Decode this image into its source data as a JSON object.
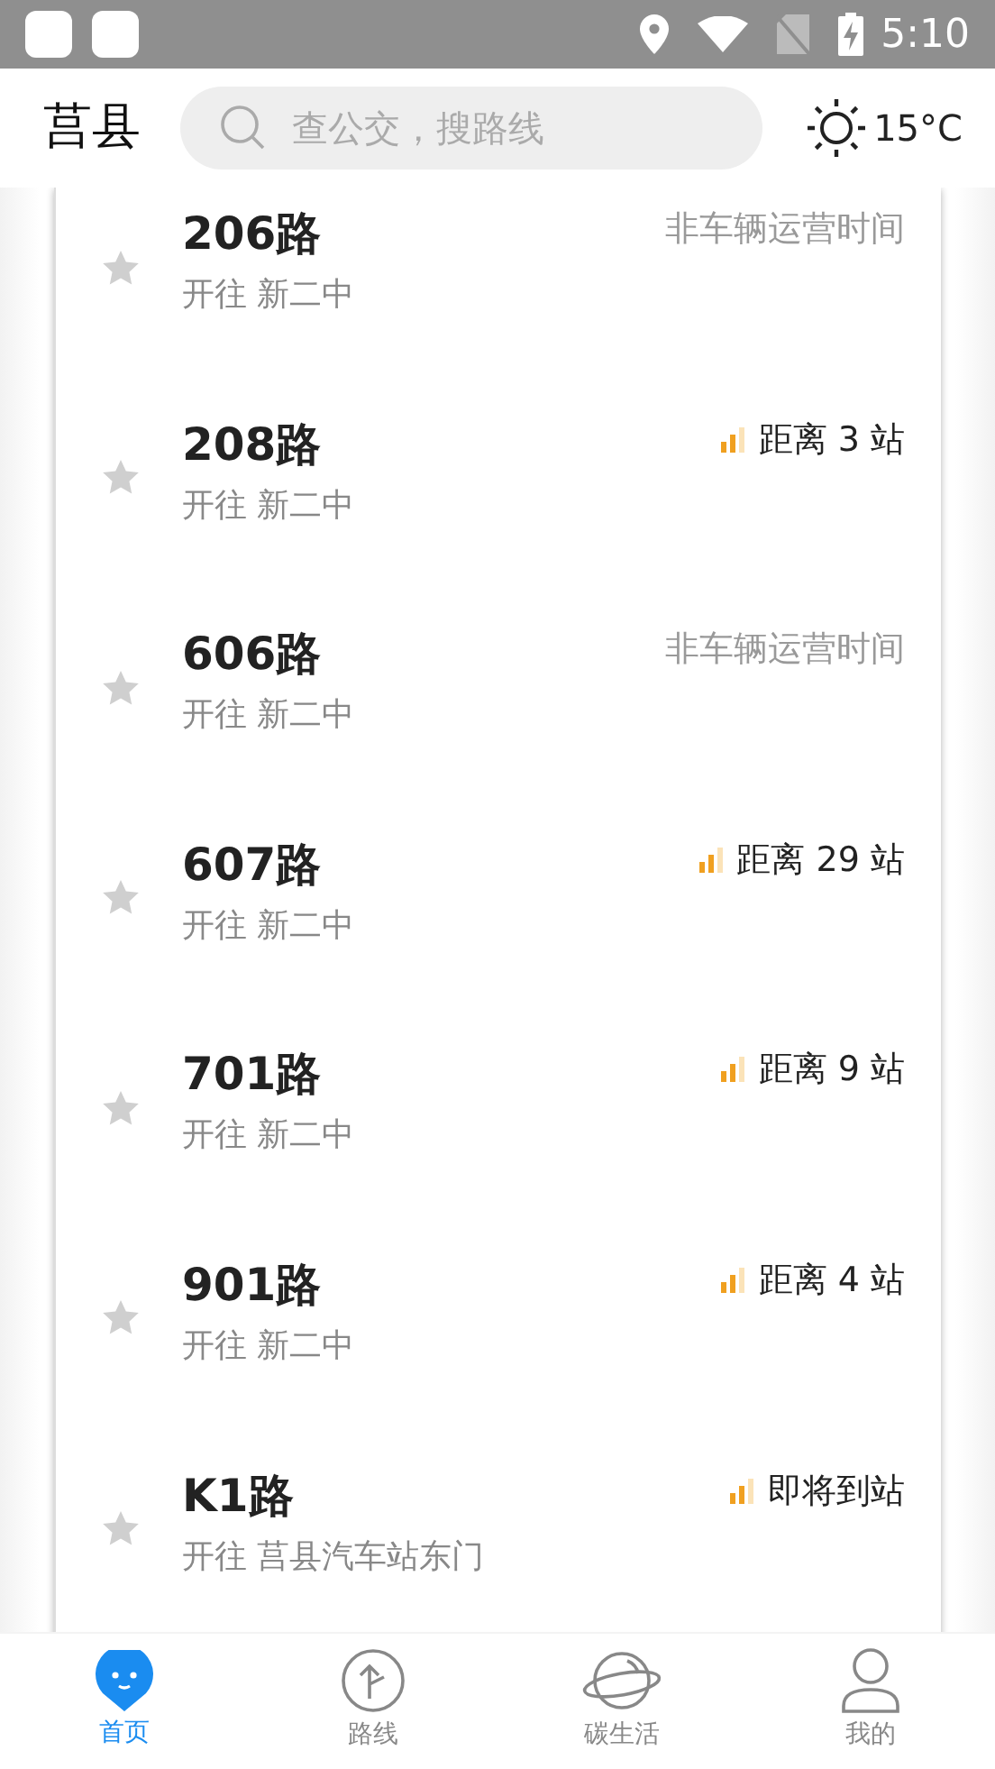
{
  "status_bar": {
    "time": "5:10"
  },
  "header": {
    "city": "莒县",
    "search": {
      "placeholder": "查公交，搜路线"
    },
    "weather": {
      "temperature": "15°C"
    }
  },
  "routes": [
    {
      "name": "206路",
      "direction": "开往 新二中",
      "kind": "status",
      "info": "非车辆运营时间",
      "starred": false
    },
    {
      "name": "208路",
      "direction": "开往 新二中",
      "kind": "distance",
      "info": "距离 3 站",
      "starred": false
    },
    {
      "name": "606路",
      "direction": "开往 新二中",
      "kind": "status",
      "info": "非车辆运营时间",
      "starred": false
    },
    {
      "name": "607路",
      "direction": "开往 新二中",
      "kind": "distance",
      "info": "距离 29 站",
      "starred": false
    },
    {
      "name": "701路",
      "direction": "开往 新二中",
      "kind": "distance",
      "info": "距离 9 站",
      "starred": false
    },
    {
      "name": "901路",
      "direction": "开往 新二中",
      "kind": "distance",
      "info": "距离 4 站",
      "starred": false
    },
    {
      "name": "K1路",
      "direction": "开往 莒县汽车站东门",
      "kind": "distance",
      "info": "即将到站",
      "starred": false
    }
  ],
  "bottom_nav": [
    {
      "label": "首页",
      "kind": "home",
      "selected": true
    },
    {
      "label": "路线",
      "kind": "route",
      "selected": false
    },
    {
      "label": "碳生活",
      "kind": "planet",
      "selected": false
    },
    {
      "label": "我的",
      "kind": "user",
      "selected": false
    }
  ]
}
